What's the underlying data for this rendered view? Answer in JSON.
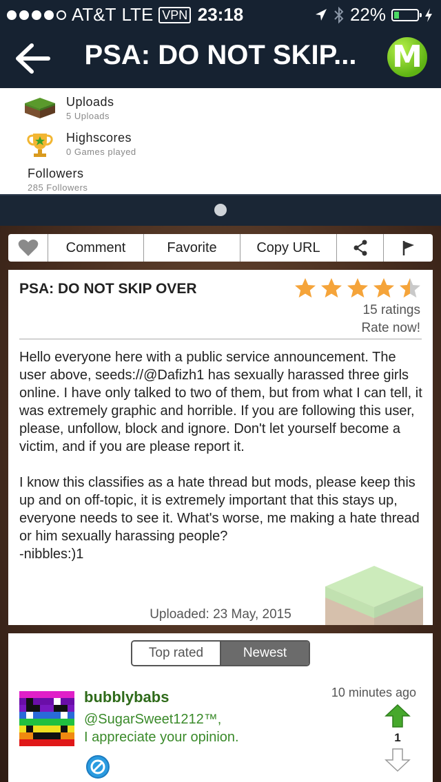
{
  "status_bar": {
    "carrier": "AT&T",
    "network": "LTE",
    "vpn": "VPN",
    "time": "23:18",
    "battery": "22%",
    "battery_level": 0.22,
    "signal_bars": 4,
    "icons": [
      "location-arrow-icon",
      "bluetooth-icon",
      "battery-icon",
      "charging-icon"
    ]
  },
  "navbar": {
    "title": "PSA: DO NOT SKIP...",
    "logo_letter": "M",
    "back_icon": "arrow-left-icon"
  },
  "profile_stats": [
    {
      "title": "Uploads",
      "subtitle": "5 Uploads",
      "icon": "grass-block-icon"
    },
    {
      "title": "Highscores",
      "subtitle": "0 Games played",
      "icon": "trophy-icon"
    },
    {
      "title": "Followers",
      "subtitle": "285 Followers"
    }
  ],
  "actions": {
    "like_icon": "heart-icon",
    "comment": "Comment",
    "favorite": "Favorite",
    "copy_url": "Copy URL",
    "share_icon": "share-icon",
    "flag_icon": "flag-icon"
  },
  "post": {
    "title": "PSA: DO NOT SKIP OVER",
    "rating": 4.5,
    "ratings_count": "15 ratings",
    "rate_now": "Rate now!",
    "body": [
      "Hello everyone here with a public service announcement. The user above, seeds://@Dafizh1 has sexually harassed three girls online. I have only talked to two of them, but from what I can tell, it was extremely graphic and horrible. If you are following this user, please, unfollow, block and ignore. Don't let yourself become a victim, and if you are please report it.",
      "I know this classifies as a hate thread but mods, please keep this up and on off-topic, it is extremely important that this stays up, everyone needs to see it. What's worse, me making a hate thread or him sexually harassing people?"
    ],
    "signature": "-nibbles:)1",
    "uploaded": "Uploaded: 23 May, 2015"
  },
  "comments": {
    "sort_tabs": [
      "Top rated",
      "Newest"
    ],
    "active_tab": "Newest",
    "items": [
      {
        "username": "bubblybabs",
        "time": "10 minutes ago",
        "text_line1": "@SugarSweet1212™,",
        "text_line2": "I appreciate your opinion.",
        "votes": "1"
      }
    ]
  },
  "colors": {
    "nav_bg": "#162231",
    "accent_green": "#5fb414",
    "username_green": "#2f6b1a",
    "star_orange": "#f5a43a",
    "page_bg_brown": "#4a2f20"
  }
}
